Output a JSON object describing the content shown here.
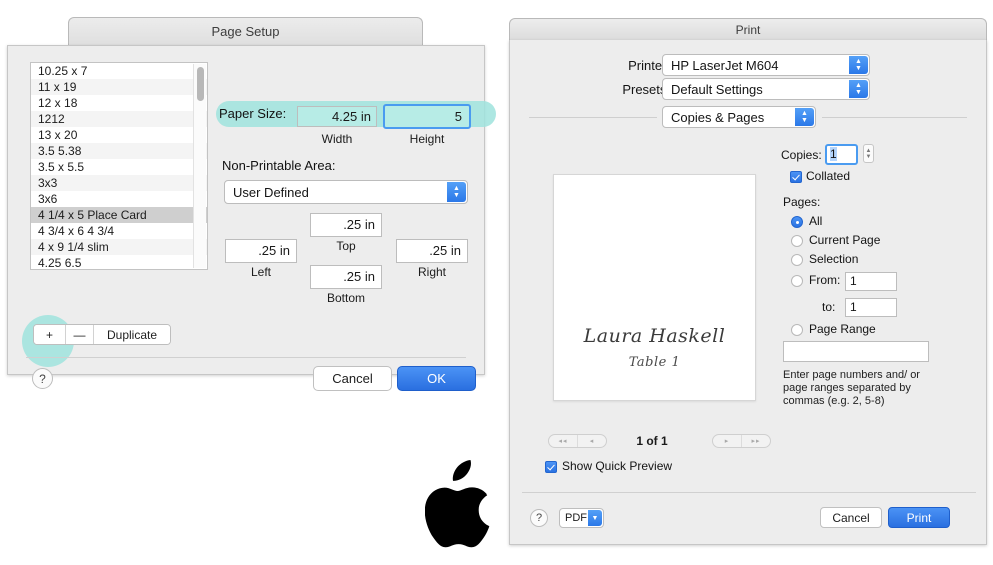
{
  "page_setup": {
    "title": "Page Setup",
    "paper_list": [
      "10.25 x 7",
      "11 x 19",
      "12 x 18",
      "1212",
      "13 x 20",
      "3.5 5.38",
      "3.5 x 5.5",
      "3x3",
      "3x6",
      "4 1/4 x 5 Place Card",
      "4 3/4 x 6 4 3/4",
      "4 x 9 1/4 slim",
      "4.25 6.5"
    ],
    "selected_paper": "4 1/4 x 5 Place Card",
    "segmented": {
      "add_label": "+",
      "remove_label": "—",
      "duplicate_label": "Duplicate"
    },
    "paper_size_label": "Paper Size:",
    "width_value": "4.25 in",
    "width_caption": "Width",
    "height_value": "5",
    "height_caption": "Height",
    "non_printable_label": "Non-Printable Area:",
    "non_printable_value": "User Defined",
    "margins": {
      "top_value": ".25 in",
      "top_caption": "Top",
      "left_value": ".25 in",
      "left_caption": "Left",
      "right_value": ".25 in",
      "right_caption": "Right",
      "bottom_value": ".25 in",
      "bottom_caption": "Bottom"
    },
    "help_label": "?",
    "cancel_label": "Cancel",
    "ok_label": "OK",
    "highlight_color": "#9fe3dd"
  },
  "print": {
    "title": "Print",
    "printer_label": "Printer:",
    "printer_value": "HP LaserJet M604",
    "presets_label": "Presets:",
    "presets_value": "Default Settings",
    "pane_value": "Copies & Pages",
    "preview": {
      "name": "Laura Haskell",
      "table": "Table 1",
      "page_count": "1 of 1",
      "first_label": "◂◂",
      "prev_label": "◂",
      "next_label": "▸",
      "last_label": "▸▸",
      "quick_preview_label": "Show Quick Preview",
      "quick_preview_checked": true
    },
    "copies_label": "Copies:",
    "copies_value": "1",
    "collated_label": "Collated",
    "collated_checked": true,
    "pages_label": "Pages:",
    "options": [
      {
        "label": "All",
        "selected": true
      },
      {
        "label": "Current Page",
        "selected": false
      },
      {
        "label": "Selection",
        "selected": false
      },
      {
        "label": "From:",
        "selected": false
      },
      {
        "label": "Page Range",
        "selected": false
      }
    ],
    "from_value": "1",
    "to_label": "to:",
    "to_value": "1",
    "range_value": "",
    "hint": "Enter page numbers and/ or page ranges separated by commas (e.g. 2, 5-8)",
    "help_label": "?",
    "pdf_label": "PDF",
    "cancel_label": "Cancel",
    "print_label": "Print",
    "accent_color": "#2a72e2"
  }
}
